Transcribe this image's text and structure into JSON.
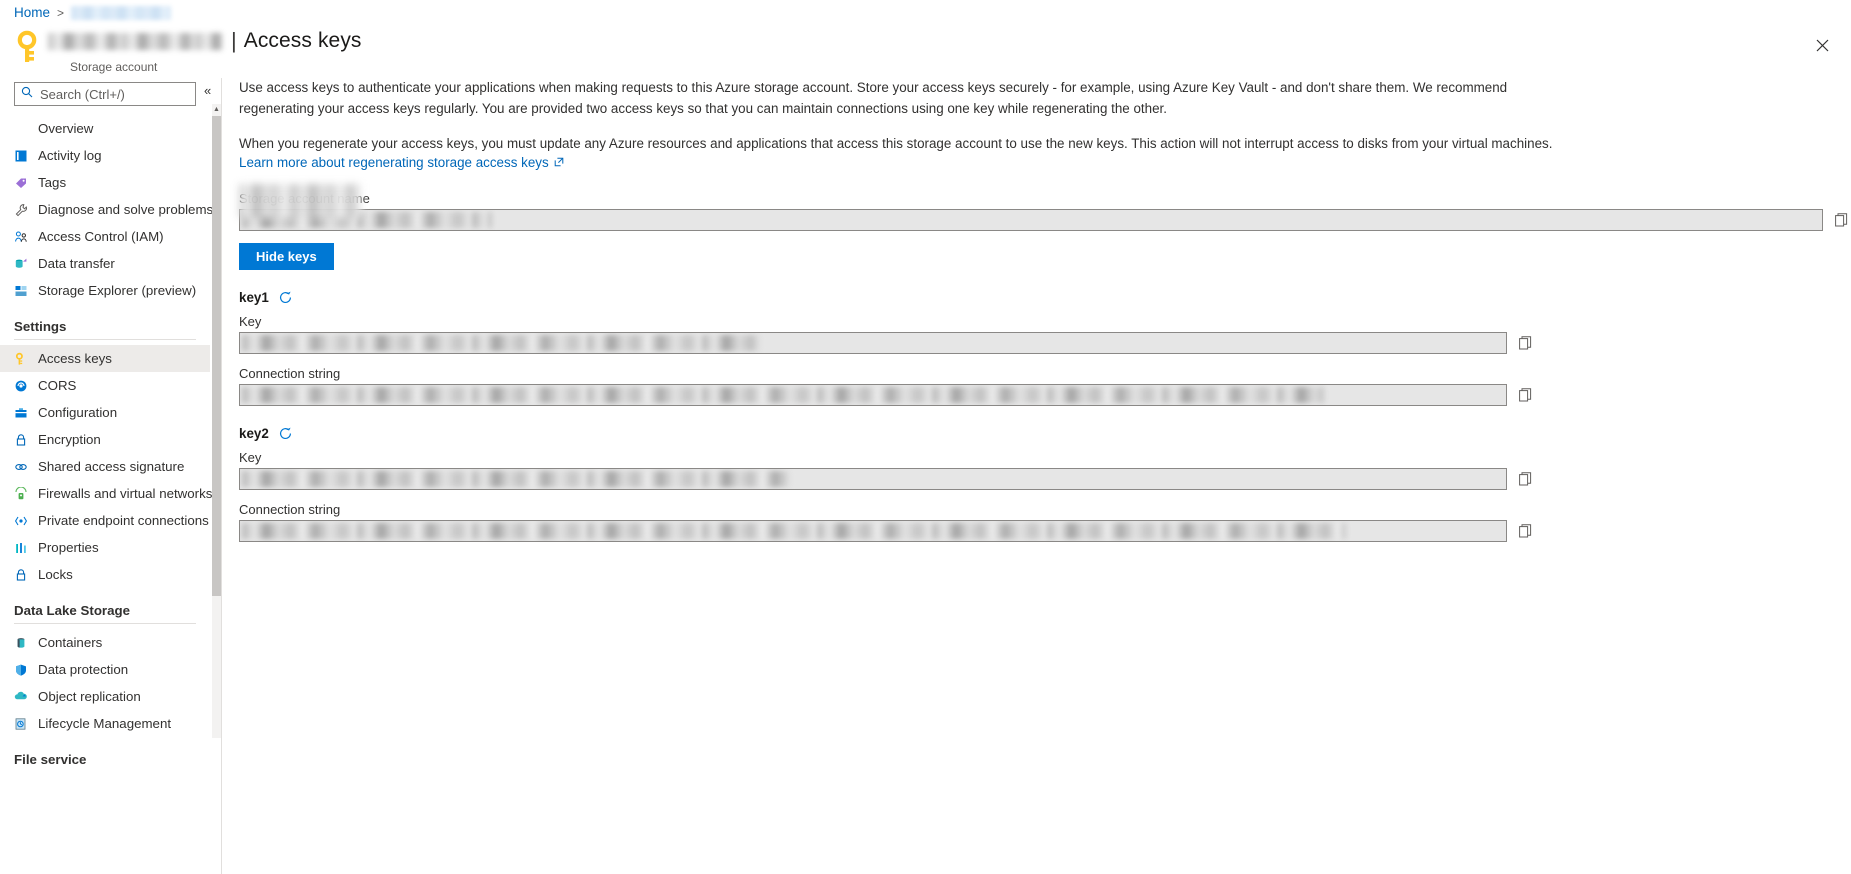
{
  "breadcrumb": {
    "home_label": "Home",
    "separator": ">",
    "resource_label_redacted": ""
  },
  "header": {
    "resource_name_redacted": "",
    "divider": "|",
    "page_title": "Access keys",
    "subtitle": "Storage account",
    "close_label": "✕"
  },
  "sidebar": {
    "search": {
      "placeholder": "Search (Ctrl+/)",
      "value": ""
    },
    "collapse_label": "«",
    "items": [
      {
        "label": "Overview",
        "icon": "",
        "selected": false
      },
      {
        "label": "Activity log",
        "icon": "activity-log-icon",
        "selected": false
      },
      {
        "label": "Tags",
        "icon": "tags-icon",
        "selected": false
      },
      {
        "label": "Diagnose and solve problems",
        "icon": "wrench-icon",
        "selected": false
      },
      {
        "label": "Access Control (IAM)",
        "icon": "people-icon",
        "selected": false
      },
      {
        "label": "Data transfer",
        "icon": "data-transfer-icon",
        "selected": false
      },
      {
        "label": "Storage Explorer (preview)",
        "icon": "storage-explorer-icon",
        "selected": false
      }
    ],
    "group_settings": {
      "label": "Settings",
      "items": [
        {
          "label": "Access keys",
          "icon": "key-icon",
          "selected": true
        },
        {
          "label": "CORS",
          "icon": "cors-icon",
          "selected": false
        },
        {
          "label": "Configuration",
          "icon": "configuration-icon",
          "selected": false
        },
        {
          "label": "Encryption",
          "icon": "lock-icon",
          "selected": false
        },
        {
          "label": "Shared access signature",
          "icon": "link-icon",
          "selected": false
        },
        {
          "label": "Firewalls and virtual networks",
          "icon": "firewall-icon",
          "selected": false
        },
        {
          "label": "Private endpoint connections",
          "icon": "endpoint-icon",
          "selected": false
        },
        {
          "label": "Properties",
          "icon": "properties-icon",
          "selected": false
        },
        {
          "label": "Locks",
          "icon": "lock-icon",
          "selected": false
        }
      ]
    },
    "group_datalake": {
      "label": "Data Lake Storage",
      "items": [
        {
          "label": "Containers",
          "icon": "container-icon",
          "selected": false
        },
        {
          "label": "Data protection",
          "icon": "shield-icon",
          "selected": false
        },
        {
          "label": "Object replication",
          "icon": "object-replication-icon",
          "selected": false
        },
        {
          "label": "Lifecycle Management",
          "icon": "lifecycle-icon",
          "selected": false
        }
      ]
    },
    "group_fileservice": {
      "label": "File service"
    }
  },
  "main": {
    "description_1": "Use access keys to authenticate your applications when making requests to this Azure storage account. Store your access keys securely - for example, using Azure Key Vault - and don't share them. We recommend regenerating your access keys regularly. You are provided two access keys so that you can maintain connections using one key while regenerating the other.",
    "description_2": "When you regenerate your access keys, you must update any Azure resources and applications that access this storage account to use the new keys. This action will not interrupt access to disks from your virtual machines.",
    "learn_more_label": "Learn more about regenerating storage access keys",
    "storage_account_name_label": "Storage account name",
    "storage_account_name_value_redacted": "",
    "hide_keys_label": "Hide keys",
    "keys": [
      {
        "name": "key1",
        "key_label": "Key",
        "key_value_redacted": "",
        "conn_label": "Connection string",
        "conn_value_redacted": ""
      },
      {
        "name": "key2",
        "key_label": "Key",
        "key_value_redacted": "",
        "conn_label": "Connection string",
        "conn_value_redacted": ""
      }
    ]
  },
  "colors": {
    "accent_blue": "#0078d4",
    "link_blue": "#0067b8",
    "selected_bg": "#edebe9",
    "input_bg": "#e6e6e6",
    "border": "#8a8886"
  }
}
